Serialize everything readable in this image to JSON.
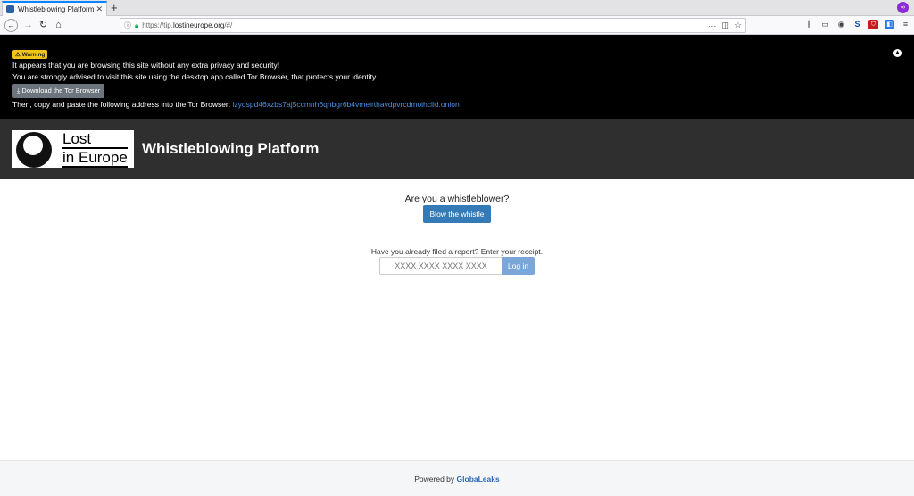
{
  "browser": {
    "tab_title": "Whistleblowing Platform",
    "new_tab": "+",
    "url_prefix": "https://tip.",
    "url_domain": "lostineurope.org",
    "url_suffix": "/#/",
    "profile_badge": "∞"
  },
  "warning": {
    "badge": "Warning",
    "line1": "It appears that you are browsing this site without any extra privacy and security!",
    "line2": "You are strongly advised to visit this site using the desktop app called Tor Browser, that protects your identity.",
    "download_label": "Download the Tor Browser",
    "line3": "Then, copy and paste the following address into the Tor Browser:",
    "onion": "lzyqspd46xzbs7aj5ccmnh6qhbgr6b4vmeirthavdpvrcdmoihclid.onion"
  },
  "header": {
    "logo_line1": "Lost",
    "logo_line2": "in Europe",
    "title": "Whistleblowing Platform"
  },
  "main": {
    "question": "Are you a whistleblower?",
    "blow_label": "Blow the whistle",
    "receipt_hint": "Have you already filed a report? Enter your receipt.",
    "receipt_placeholder": "XXXX XXXX XXXX XXXX",
    "login_label": "Log in"
  },
  "footer": {
    "powered_by": "Powered by",
    "brand": "GlobaLeaks"
  },
  "colors": {
    "primary": "#337ab7",
    "header_bg": "#2f2f2f",
    "warning_badge": "#f0c419",
    "onion_link": "#4a90e2"
  }
}
